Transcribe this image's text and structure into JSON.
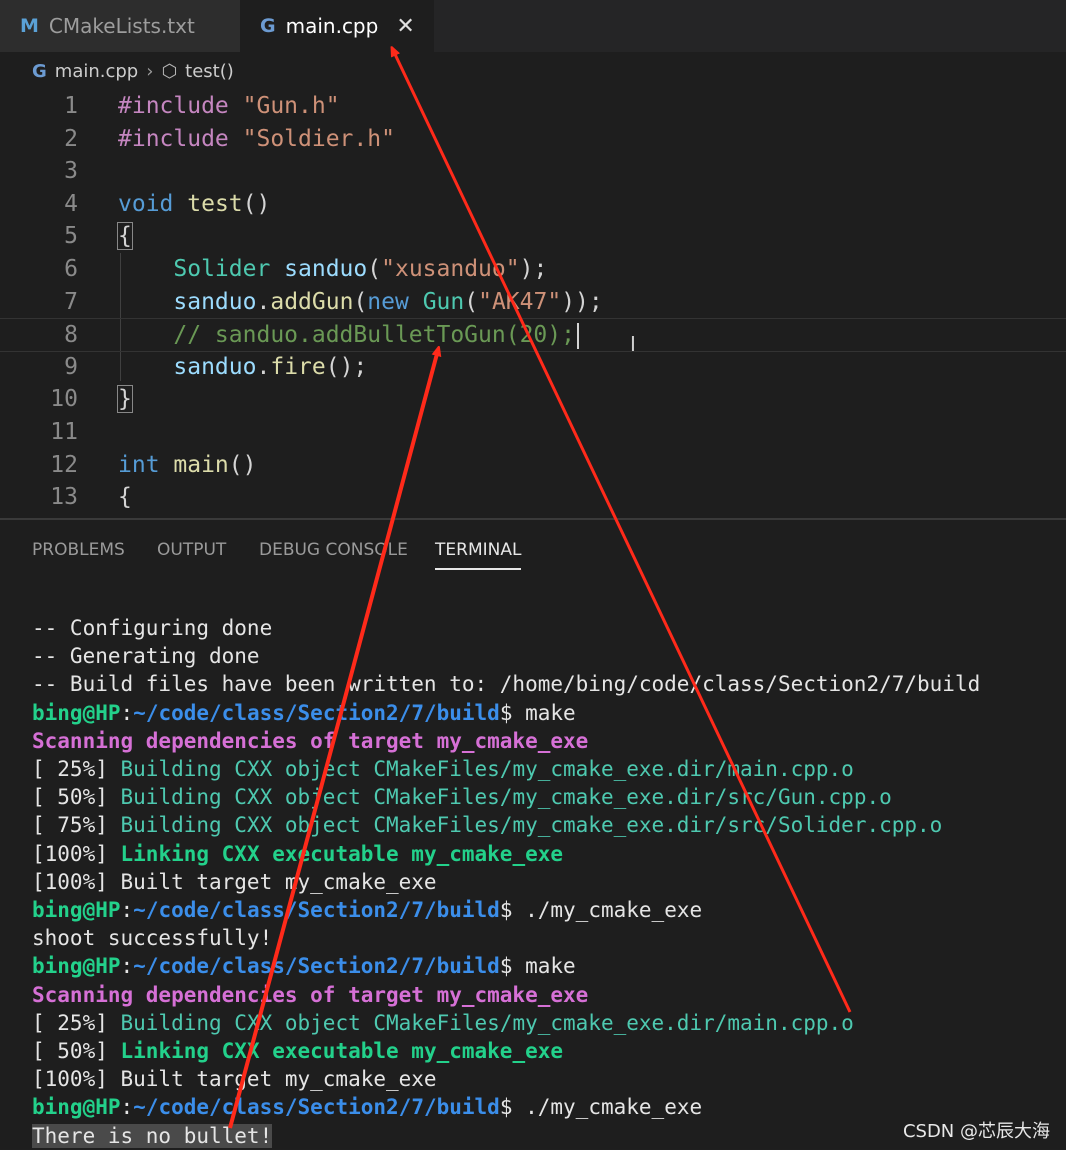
{
  "tabs": [
    {
      "icon": "M",
      "label": "CMakeLists.txt"
    },
    {
      "icon": "G",
      "label": "main.cpp",
      "close": "✕"
    }
  ],
  "breadcrumb": {
    "file": "main.cpp",
    "symbol": "test()"
  },
  "editor": {
    "lines": [
      {
        "n": "1",
        "tokens": [
          [
            "pp",
            "#include "
          ],
          [
            "str",
            "\"Gun.h\""
          ]
        ]
      },
      {
        "n": "2",
        "tokens": [
          [
            "pp",
            "#include "
          ],
          [
            "str",
            "\"Soldier.h\""
          ]
        ]
      },
      {
        "n": "3",
        "tokens": []
      },
      {
        "n": "4",
        "tokens": [
          [
            "kw",
            "void "
          ],
          [
            "fn",
            "test"
          ],
          [
            "",
            "()"
          ]
        ]
      },
      {
        "n": "5",
        "tokens": [
          [
            "",
            "{"
          ]
        ]
      },
      {
        "n": "6",
        "tokens": [
          [
            "",
            "    "
          ],
          [
            "type",
            "Solider "
          ],
          [
            "var",
            "sanduo"
          ],
          [
            "",
            "("
          ],
          [
            "str",
            "\"xusanduo\""
          ],
          [
            "",
            ");"
          ]
        ]
      },
      {
        "n": "7",
        "tokens": [
          [
            "",
            "    "
          ],
          [
            "var",
            "sanduo"
          ],
          [
            "",
            "."
          ],
          [
            "fn",
            "addGun"
          ],
          [
            "",
            "("
          ],
          [
            "kw",
            "new "
          ],
          [
            "type",
            "Gun"
          ],
          [
            "",
            "("
          ],
          [
            "str",
            "\"AK47\""
          ],
          [
            "",
            "));"
          ]
        ]
      },
      {
        "n": "8",
        "tokens": [
          [
            "",
            "    "
          ],
          [
            "cmt",
            "// sanduo.addBulletToGun(20);"
          ]
        ]
      },
      {
        "n": "9",
        "tokens": [
          [
            "",
            "    "
          ],
          [
            "var",
            "sanduo"
          ],
          [
            "",
            "."
          ],
          [
            "fn",
            "fire"
          ],
          [
            "",
            "();"
          ]
        ]
      },
      {
        "n": "10",
        "tokens": [
          [
            "",
            "}"
          ]
        ]
      },
      {
        "n": "11",
        "tokens": []
      },
      {
        "n": "12",
        "tokens": [
          [
            "kw",
            "int "
          ],
          [
            "fn",
            "main"
          ],
          [
            "",
            "()"
          ]
        ]
      },
      {
        "n": "13",
        "tokens": [
          [
            "",
            "{"
          ]
        ]
      }
    ]
  },
  "panel": {
    "tabs": [
      "PROBLEMS",
      "OUTPUT",
      "DEBUG CONSOLE",
      "TERMINAL"
    ],
    "active": "TERMINAL"
  },
  "terminal": {
    "lines": [
      [
        [
          "",
          "-- Configuring done"
        ]
      ],
      [
        [
          "",
          "-- Generating done"
        ]
      ],
      [
        [
          "",
          "-- Build files have been written to: /home/bing/code/class/Section2/7/build"
        ]
      ],
      [
        [
          "user",
          "bing@HP"
        ],
        [
          "",
          ":"
        ],
        [
          "path",
          "~/code/class/Section2/7/build"
        ],
        [
          "",
          "$ make"
        ]
      ],
      [
        [
          "mag",
          "Scanning dependencies of target my_cmake_exe"
        ]
      ],
      [
        [
          "",
          "[ 25%] "
        ],
        [
          "green",
          "Building CXX object CMakeFiles/my_cmake_exe.dir/main.cpp.o"
        ]
      ],
      [
        [
          "",
          "[ 50%] "
        ],
        [
          "green",
          "Building CXX object CMakeFiles/my_cmake_exe.dir/src/Gun.cpp.o"
        ]
      ],
      [
        [
          "",
          "[ 75%] "
        ],
        [
          "green",
          "Building CXX object CMakeFiles/my_cmake_exe.dir/src/Solider.cpp.o"
        ]
      ],
      [
        [
          "",
          "[100%] "
        ],
        [
          "lgreen",
          "Linking CXX executable my_cmake_exe"
        ]
      ],
      [
        [
          "",
          "[100%] Built target my_cmake_exe"
        ]
      ],
      [
        [
          "user",
          "bing@HP"
        ],
        [
          "",
          ":"
        ],
        [
          "path",
          "~/code/class/Section2/7/build"
        ],
        [
          "",
          "$ ./my_cmake_exe"
        ]
      ],
      [
        [
          "",
          "shoot successfully!"
        ]
      ],
      [
        [
          "user",
          "bing@HP"
        ],
        [
          "",
          ":"
        ],
        [
          "path",
          "~/code/class/Section2/7/build"
        ],
        [
          "",
          "$ make"
        ]
      ],
      [
        [
          "mag",
          "Scanning dependencies of target my_cmake_exe"
        ]
      ],
      [
        [
          "",
          "[ 25%] "
        ],
        [
          "green",
          "Building CXX object CMakeFiles/my_cmake_exe.dir/main.cpp.o"
        ]
      ],
      [
        [
          "",
          "[ 50%] "
        ],
        [
          "lgreen",
          "Linking CXX executable my_cmake_exe"
        ]
      ],
      [
        [
          "",
          "[100%] Built target my_cmake_exe"
        ]
      ],
      [
        [
          "user",
          "bing@HP"
        ],
        [
          "",
          ":"
        ],
        [
          "path",
          "~/code/class/Section2/7/build"
        ],
        [
          "",
          "$ ./my_cmake_exe"
        ]
      ],
      [
        [
          "sel",
          "There is no bullet!"
        ]
      ]
    ]
  },
  "watermark": "CSDN @芯辰大海",
  "colors": {
    "arrow": "#ff2a1a",
    "background": "#1e1e1e"
  }
}
